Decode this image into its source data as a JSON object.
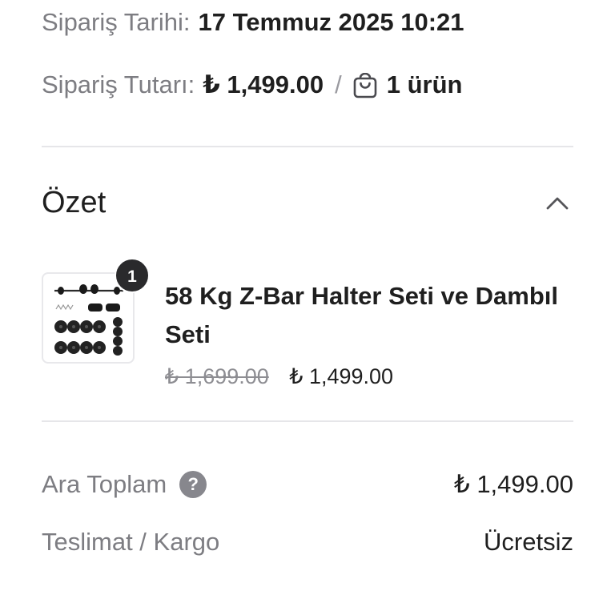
{
  "order": {
    "date_label": "Sipariş Tarihi:",
    "date_value": "17 Temmuz 2025 10:21",
    "total_label": "Sipariş Tutarı:",
    "total_value": "₺ 1,499.00",
    "separator": "/",
    "item_count": "1 ürün",
    "item_count_icon": "shopping-bag-icon"
  },
  "summary": {
    "title": "Özet",
    "toggle_icon": "chevron-up-icon",
    "product": {
      "quantity": "1",
      "name": "58 Kg Z-Bar Halter Seti ve Dambıl Seti",
      "old_price": "₺ 1,699.00",
      "price": "₺ 1,499.00",
      "image_icon": "barbell-set-image"
    }
  },
  "totals": {
    "subtotal_label": "Ara Toplam",
    "subtotal_help": "?",
    "subtotal_value": "₺ 1,499.00",
    "shipping_label": "Teslimat / Kargo",
    "shipping_value": "Ücretsiz"
  },
  "colors": {
    "label_gray": "#7d7d82",
    "text_dark": "#1f1f1f",
    "badge_dark": "#2a2a2c",
    "divider": "#e6e6e9"
  }
}
